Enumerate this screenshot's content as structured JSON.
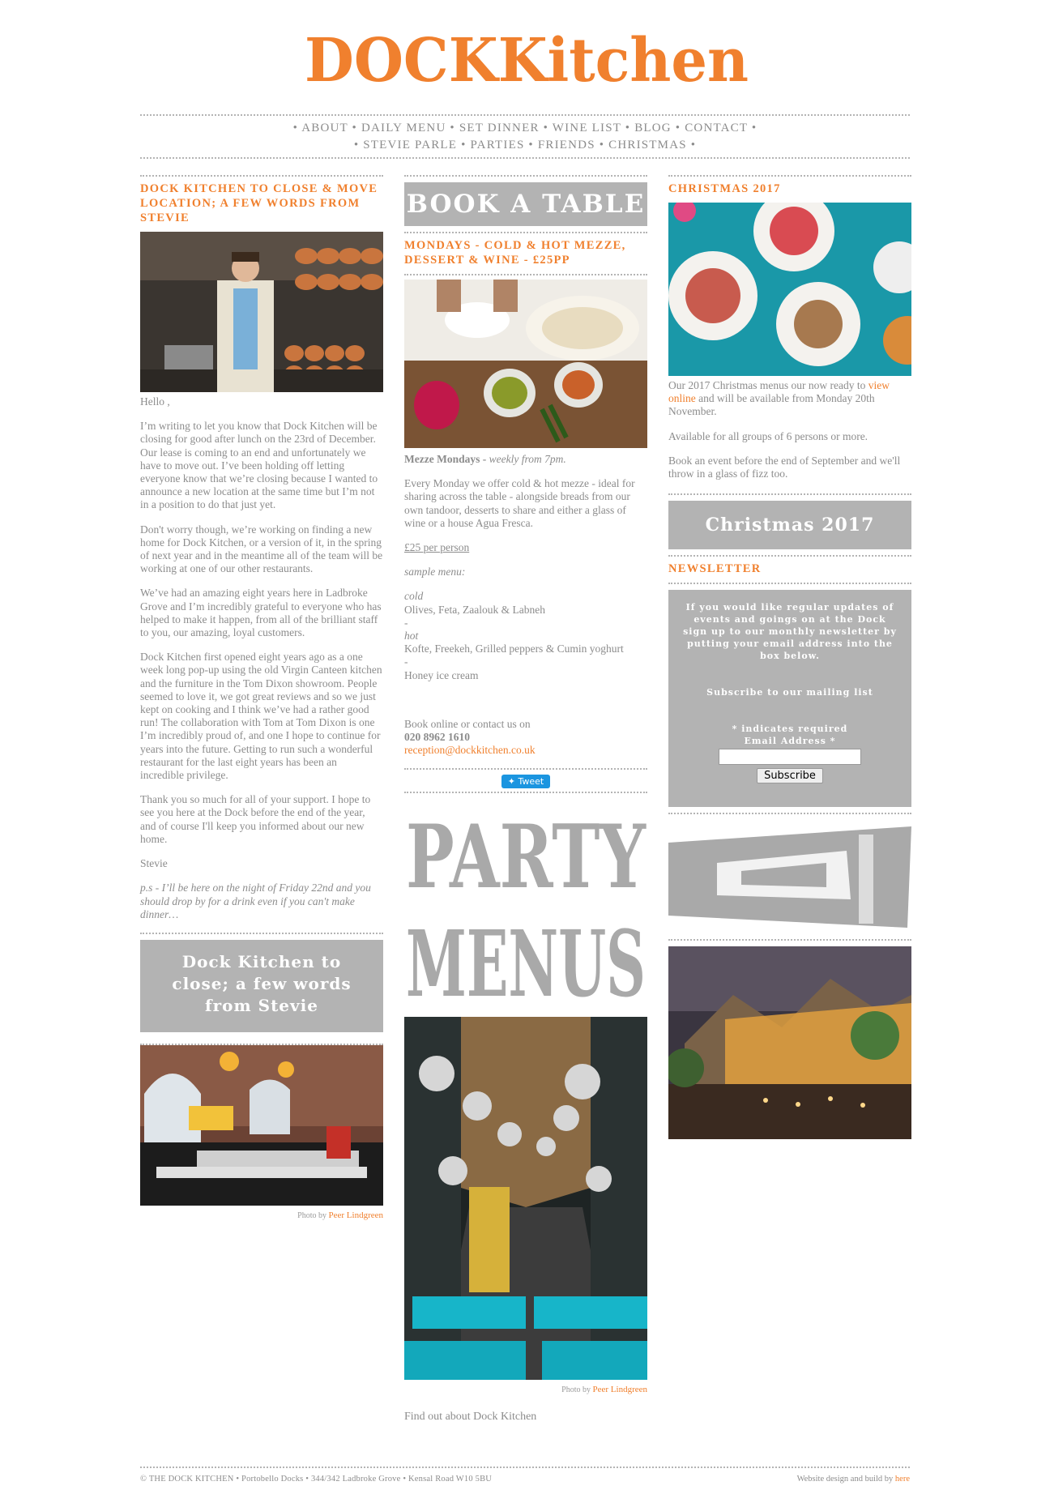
{
  "brand": {
    "logo_text": "DOCKKitchen",
    "accent": "#f0802e",
    "grey": "#b3b3b3"
  },
  "nav": {
    "row1": [
      "ABOUT",
      "DAILY MENU",
      "SET DINNER",
      "WINE LIST",
      "BLOG",
      "CONTACT"
    ],
    "row2": [
      "STEVIE PARLE",
      "PARTIES",
      "FRIENDS",
      "CHRISTMAS"
    ]
  },
  "left": {
    "heading": "DOCK KITCHEN TO CLOSE & MOVE LOCATION; A FEW WORDS FROM STEVIE",
    "p1": "Hello ,",
    "p2": "I’m writing to let you know that Dock Kitchen will be closing for good after lunch on the 23rd of December. Our lease is coming to an end and unfortunately we have to move out. I’ve been holding off letting everyone know that we’re closing because I wanted to announce a new location at the same time but I’m not in a position to do that just yet.",
    "p3": "Don't worry though, we’re working on finding a new home for Dock Kitchen, or a version of it, in the spring of next year and in the meantime all of the team will be working at one of our other restaurants.",
    "p4": "We’ve had an amazing eight years here in Ladbroke Grove and I’m incredibly grateful to everyone who has helped to make it happen, from all of the brilliant staff to you, our amazing, loyal customers.",
    "p5": "Dock Kitchen first opened eight years ago as a one week long pop-up using the old Virgin Canteen kitchen and the furniture in the Tom Dixon showroom.  People seemed to love it, we got great reviews and so we just kept on cooking and I think we’ve had a rather good run! The collaboration with Tom at Tom Dixon is one I’m incredibly proud of, and one I hope to continue for years into the future. Getting to run such a wonderful restaurant for the last eight years has been an incredible privilege.",
    "p6": "Thank you so much for all of your support. I hope to see you here at the Dock before the end of the year, and of course I'll keep you informed about our new home.",
    "p7": "Stevie",
    "p8": "p.s -  I’ll be here on the night of Friday 22nd and you should drop by for a drink even if you can't make dinner…",
    "button": "Dock Kitchen to close; a few words from Stevie",
    "photo_by": "Photo by",
    "photographer": "Peer Lindgreen"
  },
  "middle": {
    "book_table": "BOOK A TABLE",
    "heading": "MONDAYS - COLD & HOT MEZZE, DESSERT & WINE - £25PP",
    "mezze_bold": "Mezze Mondays -",
    "mezze_ital": "weekly from 7pm.",
    "desc": "Every Monday we offer cold & hot mezze - ideal for sharing across the table - alongside breads from our own tandoor, desserts to share and either a glass of wine or a house Agua Fresca.",
    "price": "£25 per person",
    "sample": "sample menu:",
    "cold_label": "cold",
    "cold": "Olives, Feta, Zaalouk & Labneh",
    "sep1": "-",
    "hot_label": "hot",
    "hot": "Kofte, Freekeh, Grilled peppers & Cumin yoghurt",
    "sep2": "-",
    "dessert": "Honey ice cream",
    "book_online": "Book online or contact us on",
    "phone": "020 8962 1610",
    "email": "reception@dockkitchen.co.uk",
    "tweet": "Tweet",
    "party": "PARTY",
    "menus": "MENUS",
    "photo_by": "Photo by",
    "photographer": "Peer Lindgreen",
    "find_out": "Find out about Dock Kitchen"
  },
  "right": {
    "heading": "CHRISTMAS 2017",
    "p1a": "Our 2017 Christmas menus our now ready to",
    "p1link": "view online",
    "p1b": "and will be available from Monday 20th November.",
    "p2": "Available for all groups of 6 persons or more.",
    "p3": "Book an event before the end of September and we'll throw in a glass of fizz too.",
    "button": "Christmas 2017",
    "newsletter_heading": "NEWSLETTER",
    "news_intro": "If you would like regular updates of events and goings on at the Dock sign up to our monthly newsletter by putting your email address into the box below.",
    "subscribe_title": "Subscribe to our mailing list",
    "required": "* indicates required",
    "email_label": "Email Address  *",
    "email_value": "",
    "subscribe_btn": "Subscribe"
  },
  "footer": {
    "left": "© THE DOCK KITCHEN • Portobello Docks • 344/342 Ladbroke Grove • Kensal Road W10 5BU",
    "right_text": "Website design and build by",
    "right_link": "here"
  }
}
